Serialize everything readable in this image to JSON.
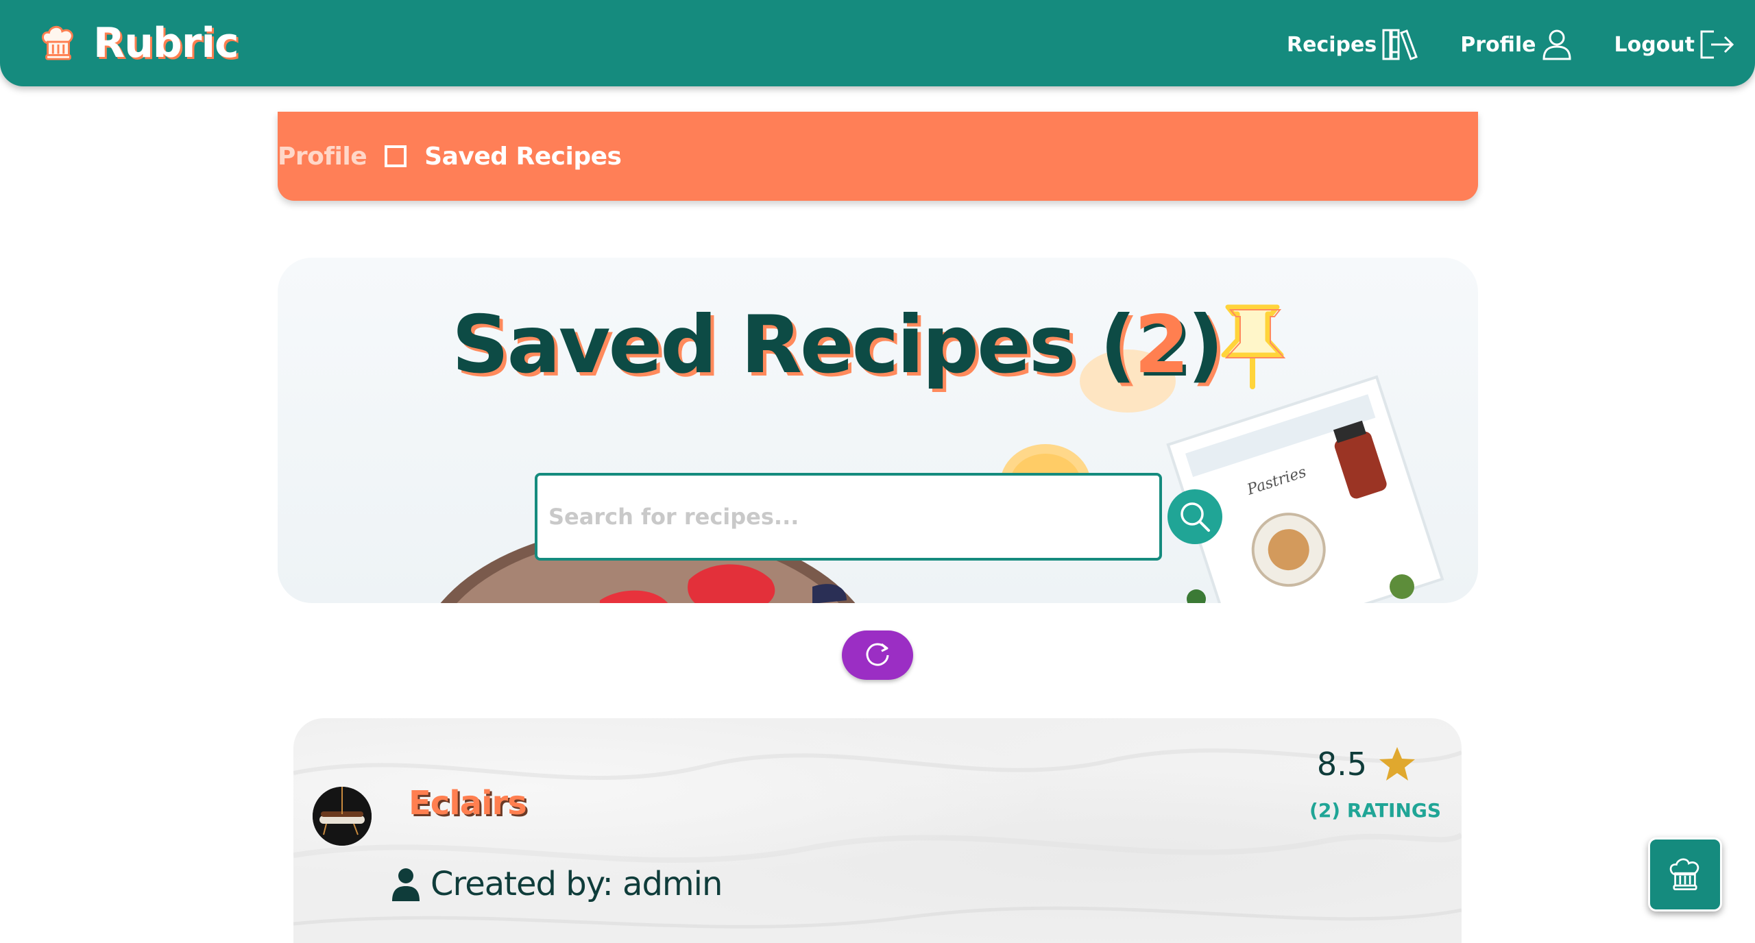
{
  "app": {
    "name": "Rubric"
  },
  "nav": {
    "recipes_label": "Recipes",
    "profile_label": "Profile",
    "logout_label": "Logout"
  },
  "breadcrumb": {
    "parent": "Profile",
    "current": "Saved Recipes"
  },
  "hero": {
    "title": "Saved Recipes",
    "count": "2",
    "search_placeholder": "Search for recipes..."
  },
  "recipes": [
    {
      "title": "Eclairs",
      "created_by": "Created by: admin",
      "rating": "8.5",
      "ratings_count": "(2) RATINGS"
    }
  ],
  "colors": {
    "primary": "#158b7e",
    "accent": "#ff7f50",
    "breadcrumb": "#ff7f57",
    "refresh": "#9b2ec4",
    "dark_text": "#0d4b45",
    "star": "#e0a82e"
  },
  "icons": {
    "brand": "chef-hat-icon",
    "recipes": "books-icon",
    "profile": "user-icon",
    "logout": "logout-icon",
    "pin": "pushpin-icon",
    "search": "search-icon",
    "refresh": "refresh-icon",
    "author": "user-icon",
    "rating": "star-icon",
    "floating": "chef-hat-icon"
  }
}
